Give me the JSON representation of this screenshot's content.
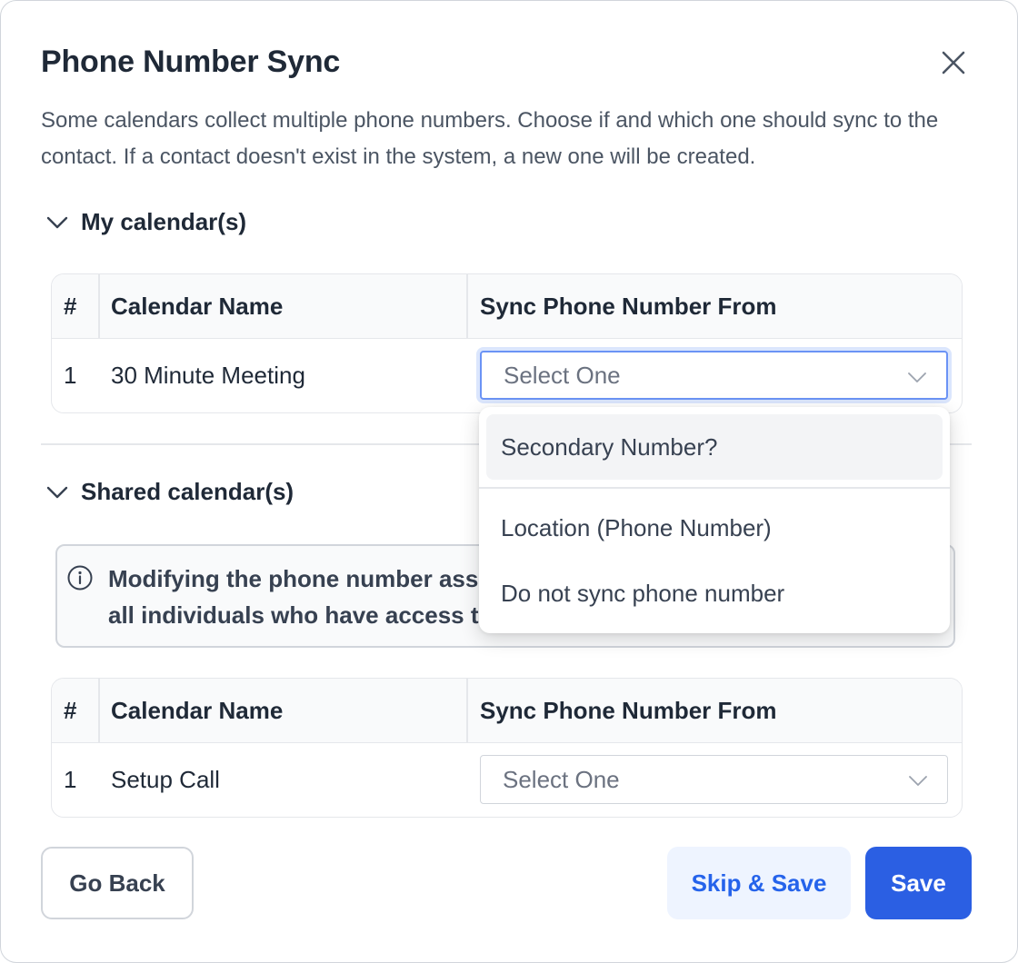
{
  "modal": {
    "title": "Phone Number Sync",
    "description": "Some calendars collect multiple phone numbers. Choose if and which one should sync to the contact. If a contact doesn't exist in the system, a new one will be created."
  },
  "my_calendars": {
    "heading": "My calendar(s)",
    "columns": [
      "#",
      "Calendar Name",
      "Sync Phone Number From"
    ],
    "rows": [
      {
        "index": "1",
        "name": "30 Minute Meeting",
        "select_value": "Select One"
      }
    ]
  },
  "dropdown": {
    "options": [
      "Secondary Number?",
      "Location (Phone Number)",
      "Do not sync phone number"
    ]
  },
  "shared_calendars": {
    "heading": "Shared calendar(s)",
    "alert_text": "Modifying the phone number ass all individuals who have access t",
    "alert_line1": "Modifying the phone number ass",
    "alert_line2": "all individuals who have access t",
    "columns": [
      "#",
      "Calendar Name",
      "Sync Phone Number From"
    ],
    "rows": [
      {
        "index": "1",
        "name": "Setup Call",
        "select_value": "Select One"
      }
    ]
  },
  "footer": {
    "go_back": "Go Back",
    "skip_save": "Skip & Save",
    "save": "Save"
  },
  "colors": {
    "primary": "#2b5fe3",
    "primary_light": "#eef4ff",
    "focus_ring": "#6b93f5"
  },
  "icons": {
    "close": "close-icon",
    "chevron": "chevron-down-icon",
    "info": "info-icon"
  }
}
